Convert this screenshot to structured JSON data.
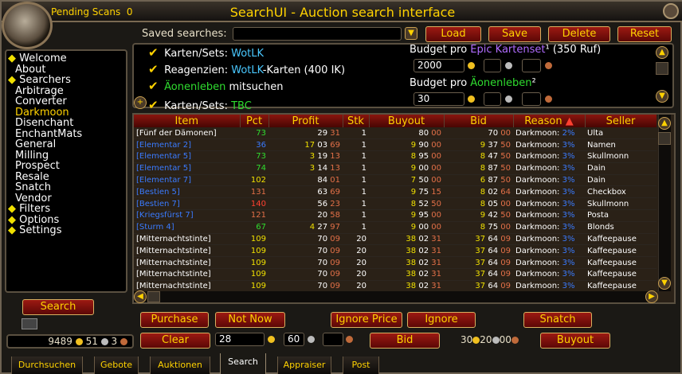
{
  "titlebar": {
    "title": "SearchUI - Auction search interface",
    "pending": "Pending Scans",
    "pending_count": "0"
  },
  "saved": {
    "label": "Saved searches:",
    "value": "",
    "load": "Load",
    "save": "Save",
    "delete": "Delete",
    "reset": "Reset"
  },
  "settings": {
    "row1": {
      "label": "Karten/Sets:",
      "value": "WotLK"
    },
    "row2": {
      "label": "Reagenzien:",
      "value": "WotLK",
      "suffix": "-Karten (400 IK)"
    },
    "row3": {
      "label": "Äonenleben",
      "suffix": "mitsuchen"
    },
    "row4": {
      "label": "Karten/Sets:",
      "value": "TBC"
    },
    "budget1": {
      "prefix": "Budget pro",
      "name": "Epic Kartenset",
      "suffix": "¹ (350 Ruf)",
      "gold": "2000"
    },
    "budget2": {
      "prefix": "Budget pro",
      "name": "Äonenleben",
      "suffix": "²",
      "gold": "30"
    }
  },
  "nav": [
    "Welcome",
    "About",
    "Searchers",
    "Arbitrage",
    "Converter",
    "Darkmoon",
    "Disenchant",
    "EnchantMats",
    "General",
    "Milling",
    "Prospect",
    "Resale",
    "Snatch",
    "Vendor",
    "Filters",
    "Options",
    "Settings"
  ],
  "search_button": "Search",
  "money": {
    "gold": "9489",
    "silver": "51",
    "copper": "3"
  },
  "table": {
    "headers": [
      "Item",
      "Pct",
      "Profit",
      "Stk",
      "Buyout",
      "Bid",
      "Reason",
      "Seller"
    ],
    "rows": [
      {
        "item": "[Fünf der Dämonen]",
        "pct": "73",
        "profit": [
          "29",
          "31"
        ],
        "stk": "1",
        "buy": [
          "80",
          "00"
        ],
        "bid": [
          "70",
          "00"
        ],
        "reason": "Darkmoon:",
        "rp": "2%",
        "seller": "Ulta",
        "ic": "wt",
        "pc": "gr"
      },
      {
        "item": "[Elementar 2]",
        "pct": "36",
        "profit": [
          "17",
          "03",
          "69"
        ],
        "stk": "1",
        "buy": [
          "9",
          "90",
          "00"
        ],
        "bid": [
          "9",
          "37",
          "50"
        ],
        "reason": "Darkmoon:",
        "rp": "3%",
        "seller": "Namen",
        "ic": "bl",
        "pc": "bl"
      },
      {
        "item": "[Elementar 5]",
        "pct": "73",
        "profit": [
          "3",
          "19",
          "13"
        ],
        "stk": "1",
        "buy": [
          "8",
          "95",
          "00"
        ],
        "bid": [
          "8",
          "47",
          "50"
        ],
        "reason": "Darkmoon:",
        "rp": "3%",
        "seller": "Skullmonn",
        "ic": "bl",
        "pc": "gr"
      },
      {
        "item": "[Elementar 5]",
        "pct": "74",
        "profit": [
          "3",
          "14",
          "13"
        ],
        "stk": "1",
        "buy": [
          "9",
          "00",
          "00"
        ],
        "bid": [
          "8",
          "87",
          "50"
        ],
        "reason": "Darkmoon:",
        "rp": "3%",
        "seller": "Dain",
        "ic": "bl",
        "pc": "gr"
      },
      {
        "item": "[Elementar 7]",
        "pct": "102",
        "profit": [
          "84",
          "01"
        ],
        "stk": "1",
        "buy": [
          "7",
          "50",
          "00"
        ],
        "bid": [
          "6",
          "87",
          "50"
        ],
        "reason": "Darkmoon:",
        "rp": "3%",
        "seller": "Dain",
        "ic": "bl",
        "pc": "y"
      },
      {
        "item": "[Bestien 5]",
        "pct": "131",
        "profit": [
          "63",
          "69"
        ],
        "stk": "1",
        "buy": [
          "9",
          "75",
          "15"
        ],
        "bid": [
          "8",
          "02",
          "64"
        ],
        "reason": "Darkmoon:",
        "rp": "3%",
        "seller": "Checkbox",
        "ic": "bl",
        "pc": "cp"
      },
      {
        "item": "[Bestien 7]",
        "pct": "140",
        "profit": [
          "56",
          "23"
        ],
        "stk": "1",
        "buy": [
          "8",
          "52",
          "50"
        ],
        "bid": [
          "8",
          "05",
          "00"
        ],
        "reason": "Darkmoon:",
        "rp": "3%",
        "seller": "Skullmonn",
        "ic": "bl",
        "pc": "r"
      },
      {
        "item": "[Kriegsfürst 7]",
        "pct": "121",
        "profit": [
          "20",
          "58"
        ],
        "stk": "1",
        "buy": [
          "9",
          "95",
          "00"
        ],
        "bid": [
          "9",
          "42",
          "50"
        ],
        "reason": "Darkmoon:",
        "rp": "3%",
        "seller": "Posta",
        "ic": "bl",
        "pc": "cp"
      },
      {
        "item": "[Sturm 4]",
        "pct": "67",
        "profit": [
          "4",
          "27",
          "97"
        ],
        "stk": "1",
        "buy": [
          "9",
          "00",
          "00"
        ],
        "bid": [
          "8",
          "75",
          "00"
        ],
        "reason": "Darkmoon:",
        "rp": "3%",
        "seller": "Blonds",
        "ic": "bl",
        "pc": "gr"
      },
      {
        "item": "[Mitternachtstinte]",
        "pct": "109",
        "profit": [
          "70",
          "09"
        ],
        "stk": "20",
        "buy": [
          "38",
          "02",
          "31"
        ],
        "bid": [
          "37",
          "64",
          "09"
        ],
        "reason": "Darkmoon:",
        "rp": "3%",
        "seller": "Kaffeepause",
        "ic": "wt",
        "pc": "y"
      },
      {
        "item": "[Mitternachtstinte]",
        "pct": "109",
        "profit": [
          "70",
          "09"
        ],
        "stk": "20",
        "buy": [
          "38",
          "02",
          "31"
        ],
        "bid": [
          "37",
          "64",
          "09"
        ],
        "reason": "Darkmoon:",
        "rp": "3%",
        "seller": "Kaffeepause",
        "ic": "wt",
        "pc": "y"
      },
      {
        "item": "[Mitternachtstinte]",
        "pct": "109",
        "profit": [
          "70",
          "09"
        ],
        "stk": "20",
        "buy": [
          "38",
          "02",
          "31"
        ],
        "bid": [
          "37",
          "64",
          "09"
        ],
        "reason": "Darkmoon:",
        "rp": "3%",
        "seller": "Kaffeepause",
        "ic": "wt",
        "pc": "y"
      },
      {
        "item": "[Mitternachtstinte]",
        "pct": "109",
        "profit": [
          "70",
          "09"
        ],
        "stk": "20",
        "buy": [
          "38",
          "02",
          "31"
        ],
        "bid": [
          "37",
          "64",
          "09"
        ],
        "reason": "Darkmoon:",
        "rp": "3%",
        "seller": "Kaffeepause",
        "ic": "wt",
        "pc": "y"
      },
      {
        "item": "[Mitternachtstinte]",
        "pct": "109",
        "profit": [
          "70",
          "09"
        ],
        "stk": "20",
        "buy": [
          "38",
          "02",
          "31"
        ],
        "bid": [
          "37",
          "64",
          "09"
        ],
        "reason": "Darkmoon:",
        "rp": "3%",
        "seller": "Kaffeepause",
        "ic": "wt",
        "pc": "y"
      }
    ]
  },
  "actions": {
    "purchase": "Purchase",
    "notnow": "Not Now",
    "ignoreprice": "Ignore Price",
    "ignore": "Ignore",
    "snatch": "Snatch",
    "clear": "Clear",
    "bid": "Bid",
    "buyout": "Buyout",
    "gold_input": "28",
    "silver_input": "60",
    "copper_input": "",
    "snatch_gold": "30",
    "snatch_silver": "20",
    "snatch_copper": "00"
  },
  "tabs": [
    "Durchsuchen",
    "Gebote",
    "Auktionen",
    "Search",
    "Appraiser",
    "Post"
  ]
}
